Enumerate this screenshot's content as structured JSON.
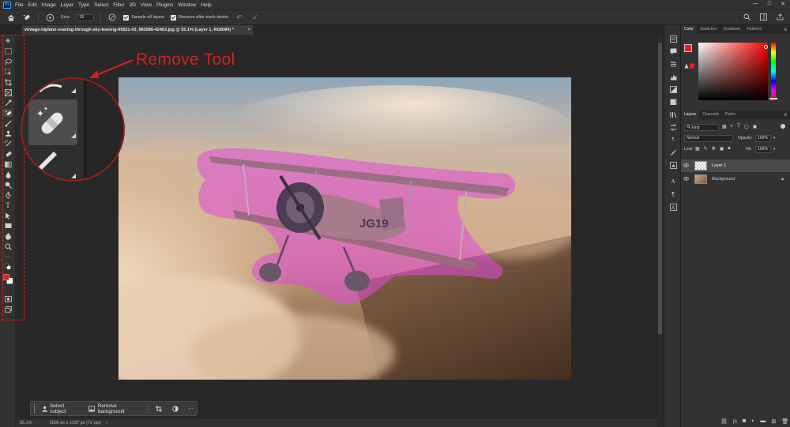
{
  "app": {
    "logo": "Ps",
    "menu": [
      "File",
      "Edit",
      "Image",
      "Layer",
      "Type",
      "Select",
      "Filter",
      "3D",
      "View",
      "Plugins",
      "Window",
      "Help"
    ],
    "window_controls": [
      "—",
      "□",
      "✕"
    ]
  },
  "options_bar": {
    "size_label": "Size:",
    "size_value": "15",
    "sample_all_layers": "Sample all layers",
    "remove_after_stroke": "Remove after each stroke"
  },
  "document": {
    "tab_title": "vintage-biplane-soaring-through-sky-leaving-00521-03_883586-42453.jpg @ 55.1% (Layer 1, RGB/8#) *",
    "tab_close": "×",
    "zoom": "55.1%",
    "dimensions": "2000 px x 1337 px (72 ppi)"
  },
  "annotation": {
    "text": "Remove Tool",
    "color": "#d41f1f"
  },
  "contextual_taskbar": {
    "select_subject": "Select subject",
    "remove_background": "Remove background",
    "more": "···"
  },
  "panels": {
    "color_tabs": [
      "Color",
      "Swatches",
      "Gradients",
      "Patterns"
    ],
    "foreground_color": "#ee1c1c",
    "background_color": "#ffffff",
    "layers_tabs": [
      "Layers",
      "Channels",
      "Paths"
    ],
    "kind_label": "Kind",
    "blend_mode": "Normal",
    "opacity_label": "Opacity:",
    "opacity_value": "100%",
    "lock_label": "Lock:",
    "fill_label": "Fill:",
    "fill_value": "100%",
    "layers": [
      {
        "name": "Layer 1",
        "selected": true
      },
      {
        "name": "Background",
        "selected": false
      }
    ]
  }
}
